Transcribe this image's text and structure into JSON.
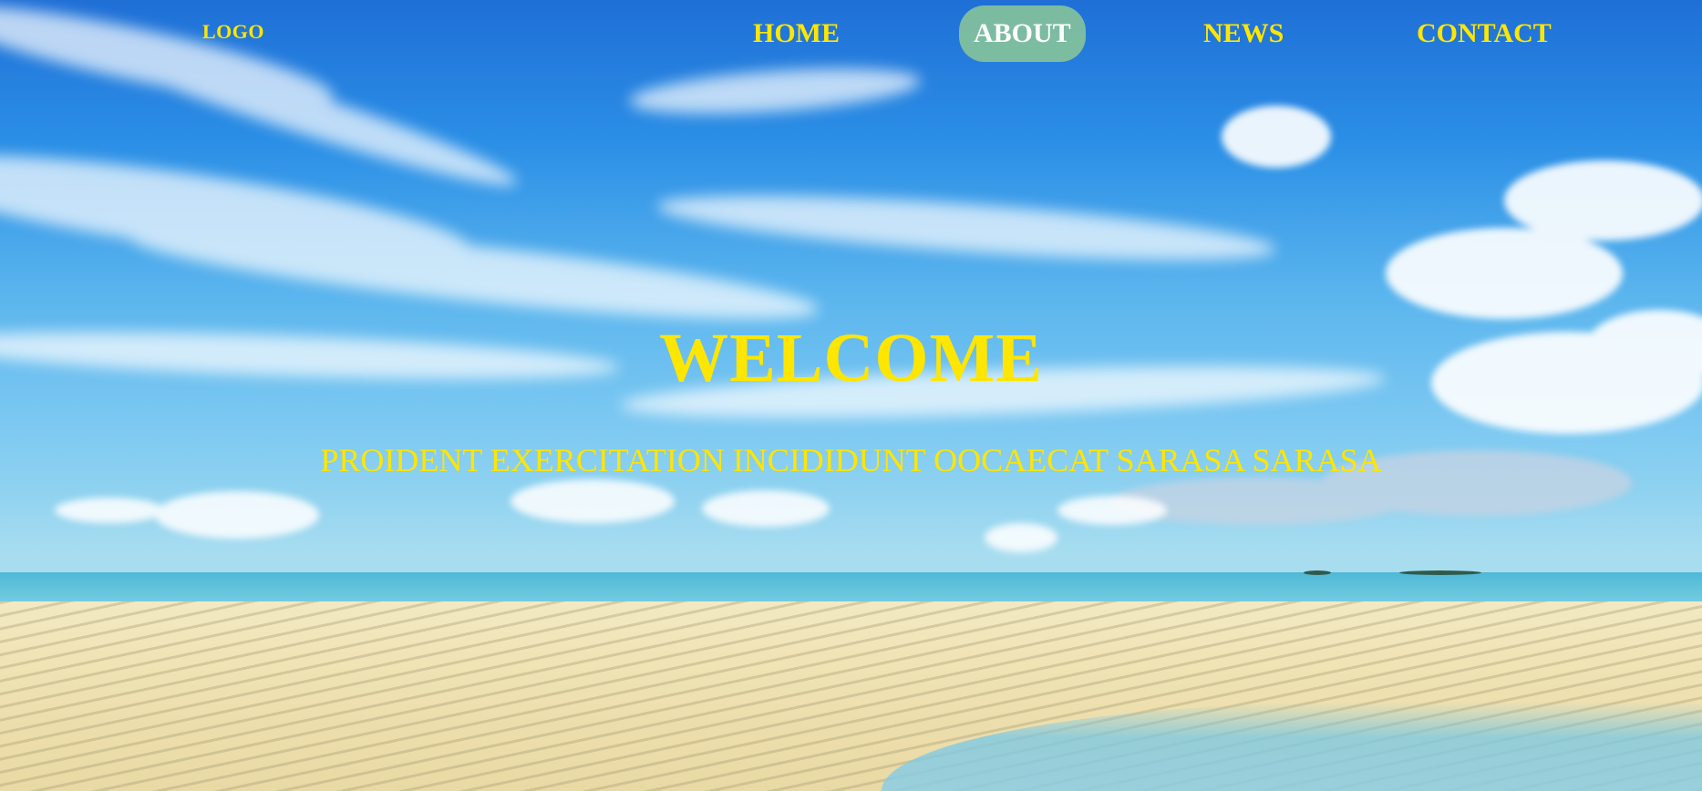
{
  "nav": {
    "logo": "LOGO",
    "items": [
      {
        "label": "HOME",
        "active": false
      },
      {
        "label": "ABOUT",
        "active": true
      },
      {
        "label": "NEWS",
        "active": false
      },
      {
        "label": "CONTACT",
        "active": false
      }
    ]
  },
  "hero": {
    "title": "WELCOME",
    "tagline": "PROIDENT EXERCITATION INCIDIDUNT OOCAECAT SARASA SARASA"
  },
  "colors": {
    "text_accent": "#ffe600",
    "active_pill": "#8cc896",
    "active_text": "#ffffff"
  }
}
